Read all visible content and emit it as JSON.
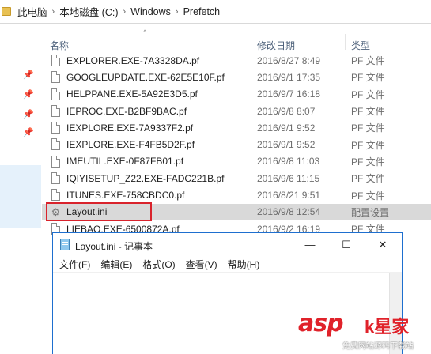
{
  "address_bar": {
    "crumbs": [
      "此电脑",
      "本地磁盘 (C:)",
      "Windows",
      "Prefetch"
    ]
  },
  "columns": {
    "name": "名称",
    "modified": "修改日期",
    "type": "类型"
  },
  "files": [
    {
      "name": "EXPLORER.EXE-7A3328DA.pf",
      "modified": "2016/8/27 8:49",
      "type": "PF 文件"
    },
    {
      "name": "GOOGLEUPDATE.EXE-62E5E10F.pf",
      "modified": "2016/9/1 17:35",
      "type": "PF 文件"
    },
    {
      "name": "HELPPANE.EXE-5A92E3D5.pf",
      "modified": "2016/9/7 16:18",
      "type": "PF 文件"
    },
    {
      "name": "IEPROC.EXE-B2BF9BAC.pf",
      "modified": "2016/9/8 8:07",
      "type": "PF 文件"
    },
    {
      "name": "IEXPLORE.EXE-7A9337F2.pf",
      "modified": "2016/9/1 9:52",
      "type": "PF 文件"
    },
    {
      "name": "IEXPLORE.EXE-F4FB5D2F.pf",
      "modified": "2016/9/1 9:52",
      "type": "PF 文件"
    },
    {
      "name": "IMEUTIL.EXE-0F87FB01.pf",
      "modified": "2016/9/8 11:03",
      "type": "PF 文件"
    },
    {
      "name": "IQIYISETUP_Z22.EXE-FADC221B.pf",
      "modified": "2016/9/6 11:15",
      "type": "PF 文件"
    },
    {
      "name": "ITUNES.EXE-758CBDC0.pf",
      "modified": "2016/8/21 9:51",
      "type": "PF 文件"
    },
    {
      "name": "Layout.ini",
      "modified": "2016/9/8 12:54",
      "type": "配置设置"
    },
    {
      "name": "LIEBAO.EXE-6500872A.pf",
      "modified": "2016/9/2 16:19",
      "type": "PF 文件"
    }
  ],
  "notepad": {
    "title": "Layout.ini - 记事本",
    "menu": [
      "文件(F)",
      "编辑(E)",
      "格式(O)",
      "查看(V)",
      "帮助(H)"
    ],
    "min_glyph": "—",
    "max_glyph": "☐",
    "close_glyph": "✕"
  },
  "watermark": {
    "logo": "asp",
    "logo_suffix": "k星家",
    "tagline": "免费网站源码下载站"
  },
  "accent_colors": {
    "highlight_border": "#d9232c",
    "selected_row": "#d9d9d9",
    "notepad_border": "#1e6fcf"
  }
}
